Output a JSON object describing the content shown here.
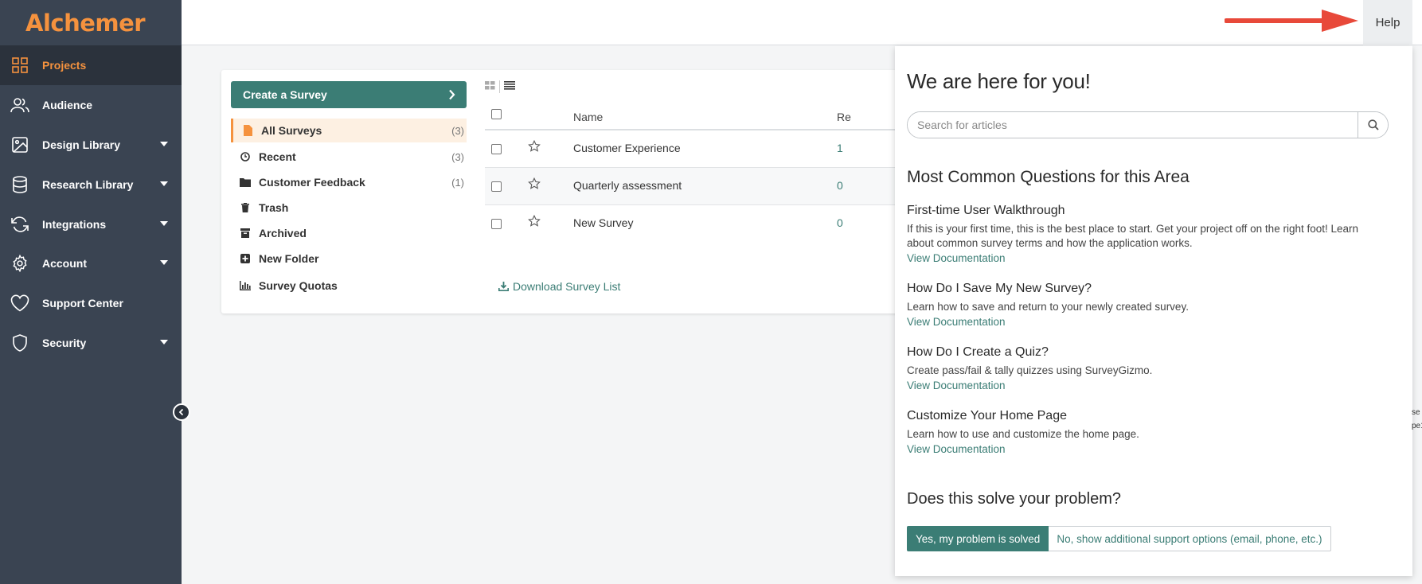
{
  "brand": {
    "logo_text": "Alchemer",
    "accent": "#f5923e",
    "teal": "#3b7d75",
    "sidebar_bg": "#3a4452"
  },
  "sidebar": {
    "items": [
      {
        "label": "Projects",
        "icon": "grid-icon",
        "active": true,
        "has_caret": false
      },
      {
        "label": "Audience",
        "icon": "users-icon",
        "has_caret": false
      },
      {
        "label": "Design Library",
        "icon": "image-icon",
        "has_caret": true
      },
      {
        "label": "Research Library",
        "icon": "database-icon",
        "has_caret": true
      },
      {
        "label": "Integrations",
        "icon": "refresh-icon",
        "has_caret": true
      },
      {
        "label": "Account",
        "icon": "gear-icon",
        "has_caret": true
      },
      {
        "label": "Support Center",
        "icon": "heart-icon",
        "has_caret": false
      },
      {
        "label": "Security",
        "icon": "shield-icon",
        "has_caret": true
      }
    ]
  },
  "topbar": {
    "help_label": "Help"
  },
  "surveys": {
    "create_label": "Create a Survey",
    "folders": [
      {
        "label": "All Surveys",
        "count": "(3)",
        "icon": "file-icon",
        "active": true
      },
      {
        "label": "Recent",
        "count": "(3)",
        "icon": "clock-icon"
      },
      {
        "label": "Customer Feedback",
        "count": "(1)",
        "icon": "folder-icon"
      },
      {
        "label": "Trash",
        "count": "",
        "icon": "trash-icon"
      },
      {
        "label": "Archived",
        "count": "",
        "icon": "archive-icon"
      },
      {
        "label": "New Folder",
        "count": "",
        "icon": "plus-square-icon"
      },
      {
        "label": "Survey Quotas",
        "count": "",
        "icon": "bar-chart-icon"
      }
    ],
    "columns": {
      "name": "Name",
      "responses": "Re"
    },
    "rows": [
      {
        "name": "Customer Experience",
        "responses": "1"
      },
      {
        "name": "Quarterly assessment",
        "responses": "0"
      },
      {
        "name": "New Survey",
        "responses": "0"
      }
    ],
    "download_label": "Download Survey List"
  },
  "help_panel": {
    "title": "We are here for you!",
    "search_placeholder": "Search for articles",
    "common_heading": "Most Common Questions for this Area",
    "questions": [
      {
        "title": "First-time User Walkthrough",
        "desc_line1": "If this is your first time, this is the best place to start. Get your project off on the right foot! Learn",
        "desc_line2": "about common survey terms and how the application works.",
        "link": "View Documentation"
      },
      {
        "title": "How Do I Save My New Survey?",
        "desc_line1": "Learn how to save and return to your newly created survey.",
        "link": "View Documentation"
      },
      {
        "title": "How Do I Create a Quiz?",
        "desc_line1": "Create pass/fail & tally quizzes using SurveyGizmo.",
        "link": "View Documentation"
      },
      {
        "title": "Customize Your Home Page",
        "desc_line1": "Learn how to use and customize the home page.",
        "link": "View Documentation"
      }
    ],
    "solve_heading": "Does this solve your problem?",
    "yes_label": "Yes, my problem is solved",
    "no_label": "No, show additional support options (email, phone, etc.)"
  },
  "edge_text": {
    "line1": "se",
    "line2": "pe1"
  }
}
